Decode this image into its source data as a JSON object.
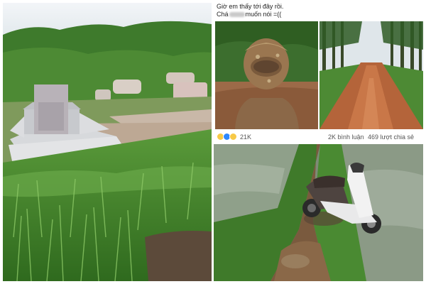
{
  "post": {
    "line1": "Giờ em thấy tới đây rồi.",
    "line2_prefix": "Chá",
    "line2_suffix": "muốn nói =(("
  },
  "reactions": {
    "count": "21K",
    "comments": "2K bình luận",
    "shares": "469 lượt chia sẻ",
    "icons": [
      "haha-icon",
      "like-icon",
      "sad-icon"
    ]
  },
  "colors": {
    "grass": "#4e8f33",
    "mud": "#a86f45",
    "sky": "#dfe8f2"
  }
}
